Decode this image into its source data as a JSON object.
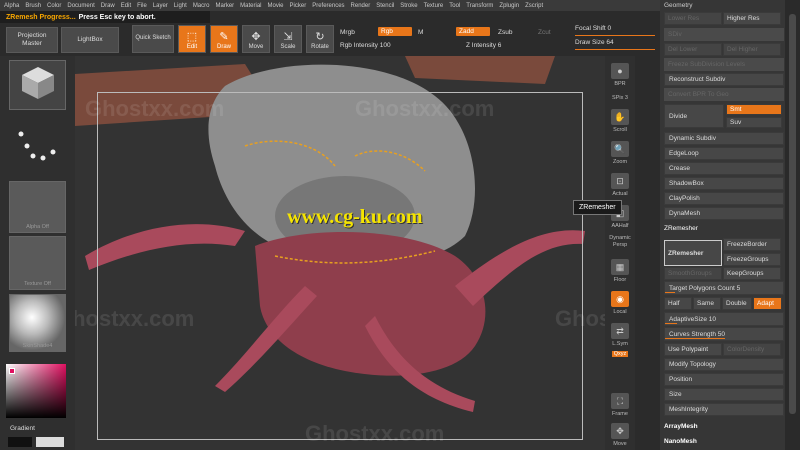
{
  "menu": [
    "Alpha",
    "Brush",
    "Color",
    "Document",
    "Draw",
    "Edit",
    "File",
    "Layer",
    "Light",
    "Macro",
    "Marker",
    "Material",
    "Movie",
    "Picker",
    "Preferences",
    "Render",
    "Stencil",
    "Stroke",
    "Texture",
    "Tool",
    "Transform",
    "Zplugin",
    "Zscript"
  ],
  "status": {
    "progress": "ZRemesh Progress...",
    "hint": "Press Esc key to abort."
  },
  "topleft": {
    "projection": "Projection Master",
    "lightbox": "LightBox"
  },
  "tools": {
    "quicksketch": "Quick Sketch",
    "edit": "Edit",
    "draw": "Draw",
    "move": "Move",
    "scale": "Scale",
    "rotate": "Rotate"
  },
  "params": {
    "mrgb": "Mrgb",
    "rgb": "Rgb",
    "m": "M",
    "zadd": "Zadd",
    "zsub": "Zsub",
    "zcut": "Zcut",
    "rgb_intensity": "Rgb Intensity 100",
    "z_intensity": "Z Intensity 6"
  },
  "focal": {
    "shift": "Focal Shift 0",
    "size": "Draw Size 64"
  },
  "left": {
    "alpha": "Alpha Off",
    "texture": "Texture Off",
    "material": "SkinShade4",
    "gradient": "Gradient"
  },
  "watermarks": [
    "Ghostxx.com",
    "Ghostxx.com",
    "Ghostxx.com",
    "Ghostxx.com",
    "Ghostxx.com"
  ],
  "cgku": "www.cg-ku.com",
  "tooltip": "ZRemesher",
  "rightstrip": [
    "BPR",
    "SPix 3",
    "Scroll",
    "Zoom",
    "Actual",
    "AAHalf",
    "Dynamic Persp",
    "Floor",
    "Local",
    "L.Sym",
    "Qxyz",
    "Frame",
    "Move"
  ],
  "rightpanel": {
    "geometry": "Geometry",
    "lowerres": "Lower Res",
    "higherres": "Higher Res",
    "sdiv": "SDiv",
    "del_lower": "Del Lower",
    "del_higher": "Del Higher",
    "freeze": "Freeze SubDivision Levels",
    "reconstruct": "Reconstruct Subdiv",
    "convert": "Convert BPR To Geo",
    "divide": "Divide",
    "smt": "Smt",
    "suv": "Suv",
    "dynsub": "Dynamic Subdiv",
    "edgeloop": "EdgeLoop",
    "crease": "Crease",
    "shadowbox": "ShadowBox",
    "claypolish": "ClayPolish",
    "dynamesh": "DynaMesh",
    "zremesher_hdr": "ZRemesher",
    "zremesher_btn": "ZRemesher",
    "freezeborder": "FreezeBorder",
    "freezegroups": "FreezeGroups",
    "smoothgroups": "SmoothGroups",
    "keepgroups": "KeepGroups",
    "target": "Target Polygons Count 5",
    "half": "Half",
    "same": "Same",
    "double": "Double",
    "adapt": "Adapt",
    "adaptivesize": "AdaptiveSize 10",
    "curves": "Curves Strength 50",
    "usepolypaint": "Use Polypaint",
    "colordensity": "ColorDensity",
    "modifytopo": "Modify Topology",
    "position": "Position",
    "size": "Size",
    "meshint": "MeshIntegrity",
    "arraymesh": "ArrayMesh",
    "nanomesh": "NanoMesh"
  },
  "colors": {
    "accent": "#e8761a",
    "tooltip_bg": "#1a1a1a"
  },
  "icons": {
    "cube": "default-3d-cube",
    "dots": "dots-stroke-icon"
  }
}
